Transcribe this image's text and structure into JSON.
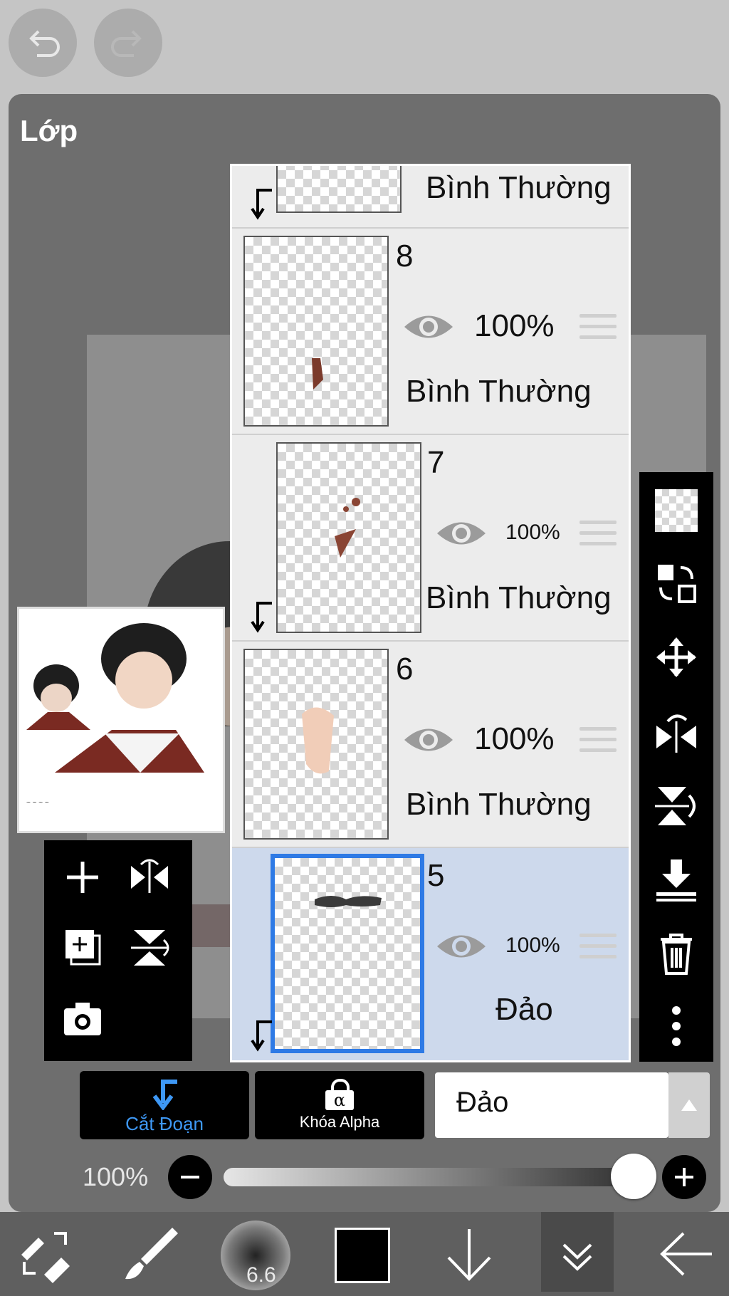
{
  "top_bar": {
    "undo_icon": "undo-icon",
    "redo_icon": "redo-icon"
  },
  "panel": {
    "title": "Lớp"
  },
  "layers": [
    {
      "number": "",
      "opacity": "",
      "blend_mode": "Bình Thường",
      "clipped": true,
      "selected": false
    },
    {
      "number": "8",
      "opacity": "100%",
      "blend_mode": "Bình Thường",
      "clipped": false,
      "selected": false
    },
    {
      "number": "7",
      "opacity": "100%",
      "blend_mode": "Bình Thường",
      "clipped": true,
      "selected": false
    },
    {
      "number": "6",
      "opacity": "100%",
      "blend_mode": "Bình Thường",
      "clipped": false,
      "selected": false
    },
    {
      "number": "5",
      "opacity": "100%",
      "blend_mode": "Đảo",
      "clipped": true,
      "selected": true
    }
  ],
  "layer_actions": {
    "clipping_label": "Cắt Đoạn",
    "alpha_lock_label": "Khóa Alpha",
    "alpha_symbol": "α",
    "blend_mode_value": "Đảo"
  },
  "opacity_slider": {
    "label": "100%",
    "value_percent": 100
  },
  "bottom_bar": {
    "brush_size": "6.6",
    "color": "#000000"
  },
  "colors": {
    "accent": "#2e7ae5",
    "selected_row": "#cdd9ec"
  }
}
